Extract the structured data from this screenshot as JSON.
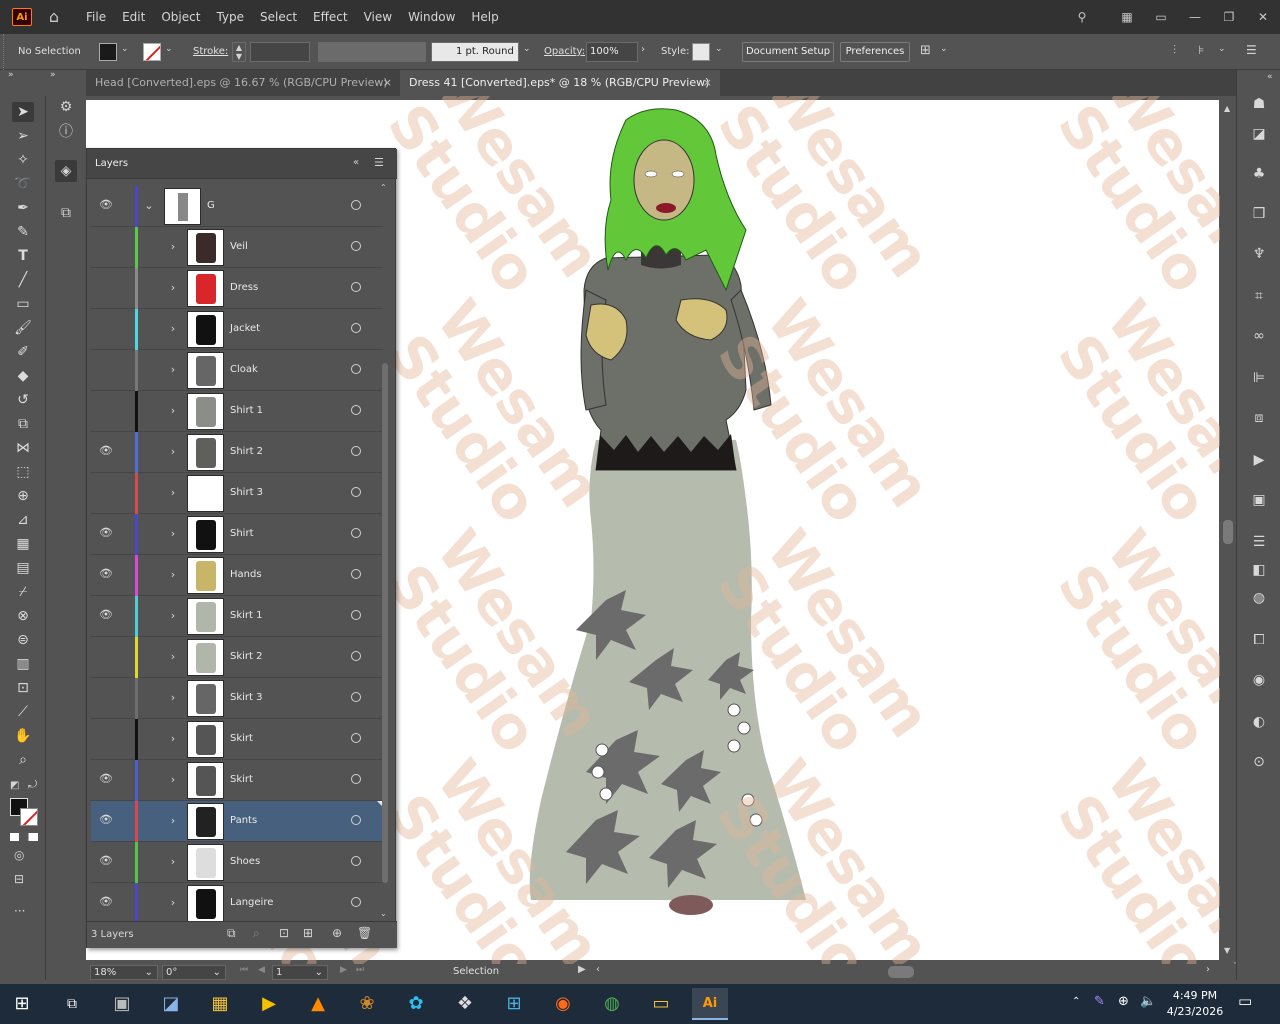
{
  "menu": {
    "app_logo": "Ai",
    "items": [
      "File",
      "Edit",
      "Object",
      "Type",
      "Select",
      "Effect",
      "View",
      "Window",
      "Help"
    ]
  },
  "control": {
    "selection_label": "No Selection",
    "stroke_label": "Stroke:",
    "brush_label": "1 pt. Round",
    "opacity_label": "Opacity:",
    "opacity_value": "100%",
    "style_label": "Style:",
    "document_setup": "Document Setup",
    "preferences": "Preferences"
  },
  "tabs": [
    {
      "label": "Head [Converted].eps @ 16.67 % (RGB/CPU Preview)",
      "close": "×"
    },
    {
      "label": "Dress 41 [Converted].eps* @ 18 % (RGB/CPU Preview)",
      "close": "×"
    }
  ],
  "layers_panel": {
    "title": "Layers",
    "parent": {
      "name": "G"
    },
    "rows": [
      {
        "name": "Veil",
        "color": "#59c949",
        "visible": false
      },
      {
        "name": "Dress",
        "color": "#8a8a8a",
        "visible": false
      },
      {
        "name": "Jacket",
        "color": "#4fd6e5",
        "visible": false
      },
      {
        "name": "Cloak",
        "color": "#777777",
        "visible": false
      },
      {
        "name": "Shirt 1",
        "color": "#111111",
        "visible": false
      },
      {
        "name": "Shirt 2",
        "color": "#4f6fd8",
        "visible": true
      },
      {
        "name": "Shirt 3",
        "color": "#d84b4b",
        "visible": false
      },
      {
        "name": "Shirt",
        "color": "#4a47c9",
        "visible": true
      },
      {
        "name": "Hands",
        "color": "#d94ad5",
        "visible": true
      },
      {
        "name": "Skirt 1",
        "color": "#4ecfd6",
        "visible": true
      },
      {
        "name": "Skirt 2",
        "color": "#e2d72e",
        "visible": false
      },
      {
        "name": "Skirt 3",
        "color": "#6e6e6e",
        "visible": false
      },
      {
        "name": "Skirt",
        "color": "#111111",
        "visible": false
      },
      {
        "name": "Skirt",
        "color": "#4a62d0",
        "visible": true
      },
      {
        "name": "Pants",
        "color": "#d84848",
        "visible": true,
        "selected": true
      },
      {
        "name": "Shoes",
        "color": "#55c548",
        "visible": true
      },
      {
        "name": "Langeire",
        "color": "#4a47c9",
        "visible": true
      }
    ],
    "footer_count": "3 Layers"
  },
  "status": {
    "zoom": "18%",
    "rotation": "0°",
    "artboard_number": "1",
    "tool_name": "Selection"
  },
  "watermark": {
    "line1": "Wesam",
    "line2": "Studio"
  },
  "taskbar": {
    "time": "4:49 PM",
    "date": "4/23/2026"
  },
  "colors": {
    "accent": "#ff9a00",
    "selection_row": "#46607d",
    "canvas": "#ffffff"
  }
}
